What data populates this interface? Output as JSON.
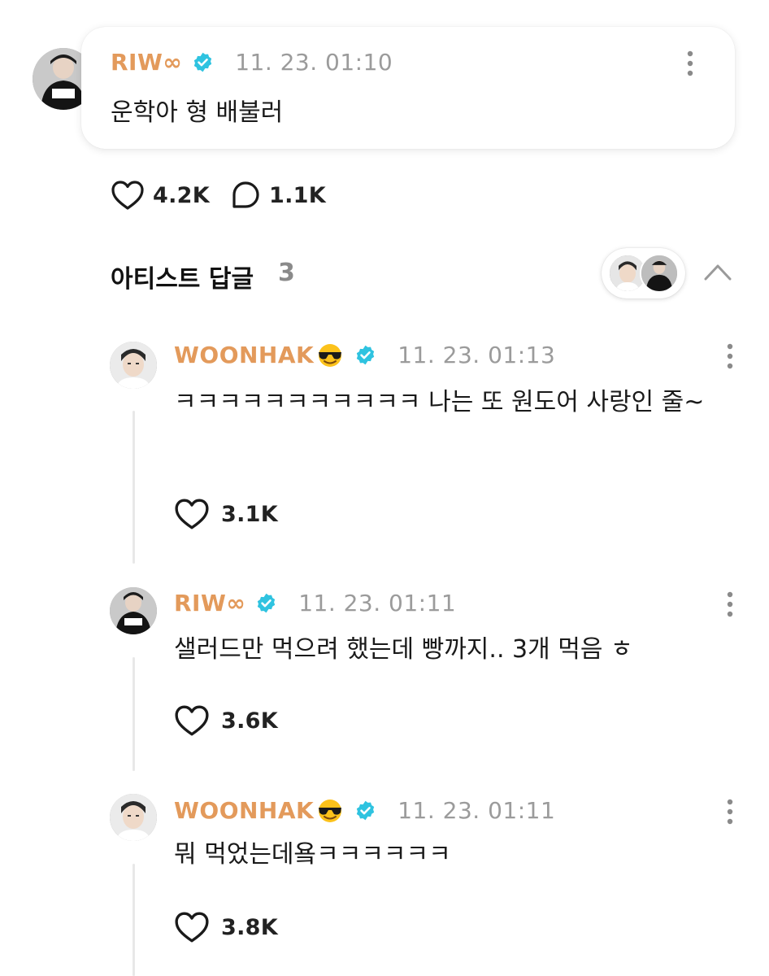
{
  "post": {
    "author": "RIW∞",
    "timestamp": "11. 23. 01:10",
    "text": "운학아 형 배불러",
    "likes": "4.2K",
    "comments": "1.1K"
  },
  "replies_section": {
    "title": "아티스트 답글",
    "count": "3"
  },
  "replies": [
    {
      "author": "WOONHAK",
      "emoji": "😎",
      "timestamp": "11. 23. 01:13",
      "text": "ㅋㅋㅋㅋㅋㅋㅋㅋㅋㅋㅋ 나는 또 원도어 사랑인 줄~",
      "likes": "3.1K"
    },
    {
      "author": "RIW∞",
      "timestamp": "11. 23. 01:11",
      "text": "샐러드만 먹으려 했는데 빵까지.. 3개 먹음 ㅎ",
      "likes": "3.6K"
    },
    {
      "author": "WOONHAK",
      "emoji": "😎",
      "timestamp": "11. 23. 01:11",
      "text": "뭐 먹었는데욬ㅋㅋㅋㅋㅋㅋ",
      "likes": "3.8K"
    }
  ],
  "colors": {
    "author": "#e39a5b",
    "verified": "#2fc3e0",
    "timestamp": "#9b9b9b"
  },
  "icons": [
    "heart-icon",
    "comment-icon",
    "verified-badge-icon",
    "more-options-icon",
    "chevron-up-icon",
    "sunglasses-emoji-icon"
  ]
}
